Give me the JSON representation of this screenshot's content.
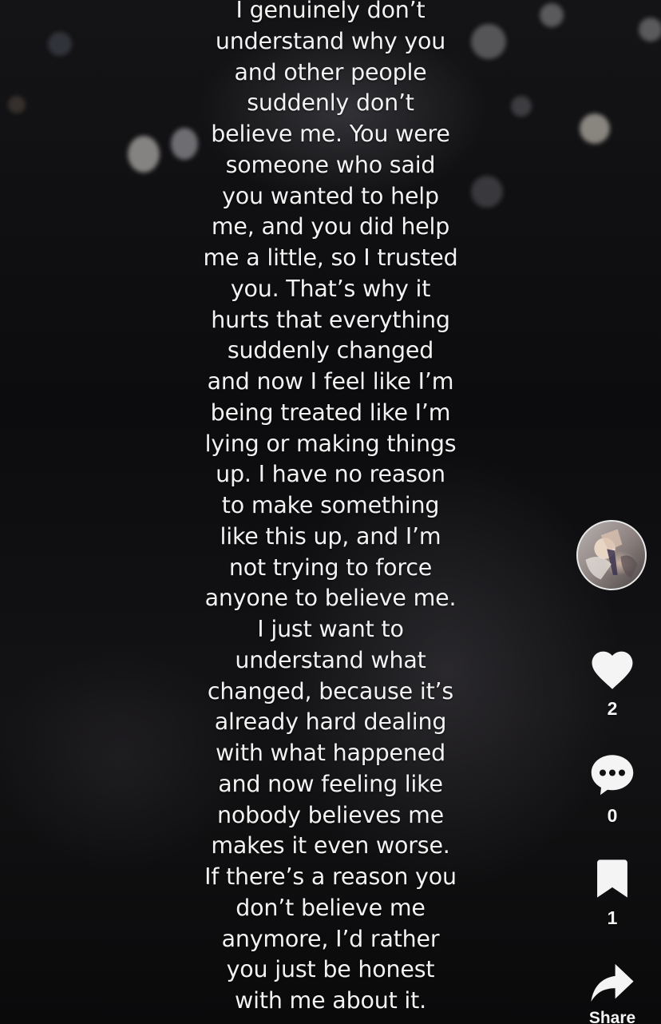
{
  "post": {
    "caption": "I genuinely don’t\nunderstand why you\nand other people\nsuddenly don’t\nbelieve me. You were\nsomeone who said\nyou wanted to help\nme, and you did help\nme a little, so I trusted\nyou. That’s why it\nhurts that everything\nsuddenly changed\nand now I feel like I’m\nbeing treated like I’m\nlying or making things\nup. I have no reason\nto make something\nlike this up, and I’m\nnot trying to force\nanyone to believe me.\nI just want to\nunderstand what\nchanged, because it’s\nalready hard dealing\nwith what happened\nand now feeling like\nnobody believes me\nmakes it even worse.\nIf there’s a reason you\ndon’t believe me\nanymore, I’d rather\nyou just be honest\nwith me about it."
  },
  "actions": {
    "like": {
      "icon": "heart-icon",
      "count": "2"
    },
    "comment": {
      "icon": "comment-icon",
      "count": "0"
    },
    "save": {
      "icon": "bookmark-icon",
      "count": "1"
    },
    "share": {
      "icon": "share-arrow-icon",
      "label": "Share"
    }
  },
  "colors": {
    "text": "#f2f2f2",
    "background": "#0c0c0e",
    "icon": "#f4f4f4"
  }
}
